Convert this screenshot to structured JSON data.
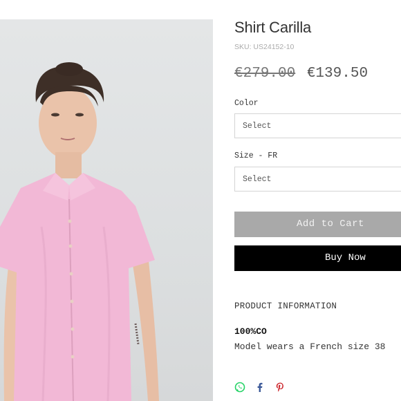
{
  "product": {
    "title": "Shirt Carilla",
    "sku": "SKU: US24152-10",
    "old_price": "€279.00",
    "new_price": "€139.50"
  },
  "options": {
    "color_label": "Color",
    "color_value": "Select",
    "size_label": "Size - FR",
    "size_value": "Select"
  },
  "actions": {
    "add_to_cart": "Add to Cart",
    "buy_now": "Buy Now"
  },
  "info": {
    "heading": "PRODUCT INFORMATION",
    "material": "100%CO",
    "model_note": "Model wears a French size 38"
  },
  "share": {
    "icons": [
      "whatsapp-icon",
      "facebook-icon",
      "pinterest-icon"
    ],
    "colors": {
      "whatsapp": "#25d366",
      "facebook": "#3b5998",
      "pinterest": "#cb2027"
    }
  },
  "photo": {
    "subject": "product-photo",
    "shirt_color": "#f2b8d6"
  }
}
